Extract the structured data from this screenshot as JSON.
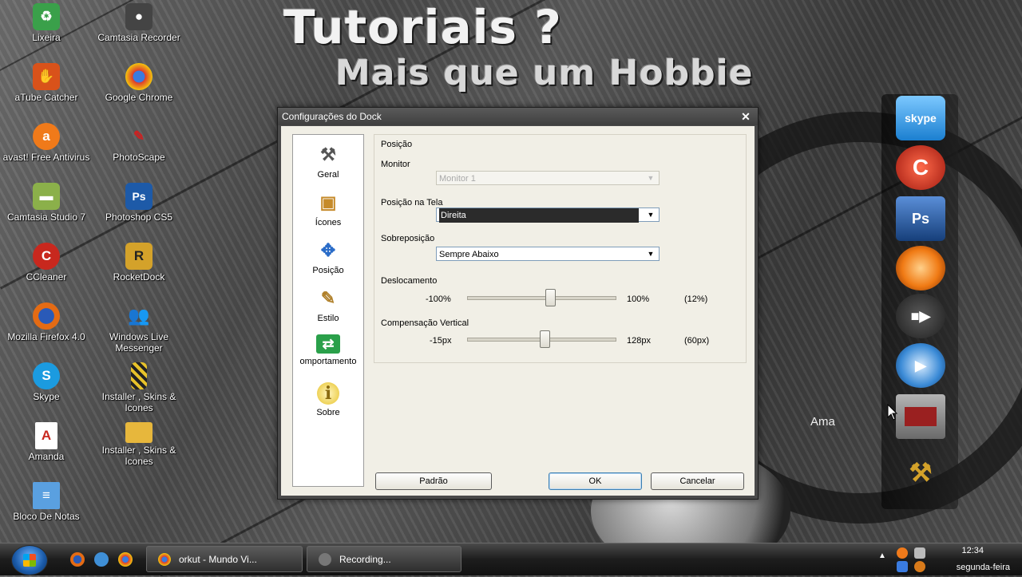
{
  "desktop": {
    "banner_line1": "Tutoriais ?",
    "banner_line2": "Mais que um Hobbie",
    "background_text": "Ama",
    "icons": [
      {
        "label": "Lixeira",
        "icon": "recycle-bin-icon",
        "color": "#3aa04a"
      },
      {
        "label": "Camtasia Recorder",
        "icon": "camtasia-recorder-icon",
        "color": "#444444"
      },
      {
        "label": "aTube Catcher",
        "icon": "atube-catcher-icon",
        "color": "#d9521a"
      },
      {
        "label": "Google Chrome",
        "icon": "chrome-icon",
        "color": "#dd3a2e"
      },
      {
        "label": "avast! Free Antivirus",
        "icon": "avast-icon",
        "color": "#f07a1a"
      },
      {
        "label": "PhotoScape",
        "icon": "photoscape-icon",
        "color": "#cc2222"
      },
      {
        "label": "Camtasia Studio 7",
        "icon": "camtasia-studio-icon",
        "color": "#8bb04a"
      },
      {
        "label": "Photoshop CS5",
        "icon": "photoshop-icon",
        "color": "#1d5aa8"
      },
      {
        "label": "CCleaner",
        "icon": "ccleaner-icon",
        "color": "#c8281e"
      },
      {
        "label": "RocketDock",
        "icon": "rocketdock-icon",
        "color": "#d4a22a"
      },
      {
        "label": "Mozilla Firefox 4.0",
        "icon": "firefox-icon",
        "color": "#e46b14"
      },
      {
        "label": "Windows Live Messenger",
        "icon": "messenger-icon",
        "color": "#3f8fd6"
      },
      {
        "label": "Skype",
        "icon": "skype-icon",
        "color": "#1b9be0"
      },
      {
        "label": "Installer , Skins & Icones",
        "icon": "installer-icon",
        "color": "#2a2a2a"
      },
      {
        "label": "Amanda",
        "icon": "document-icon",
        "color": "#ffffff"
      },
      {
        "label": "Installer , Skins & Icones",
        "icon": "folder-icon",
        "color": "#e7b73c"
      },
      {
        "label": "Bloco De Notas",
        "icon": "notepad-icon",
        "color": "#5aa0e0"
      }
    ]
  },
  "dock": {
    "items": [
      {
        "icon": "skype-dock-icon",
        "text": "skype",
        "color": "#2a9be0"
      },
      {
        "icon": "ccleaner-dock-icon",
        "text": "C",
        "color": "#c8281e"
      },
      {
        "icon": "photoshop-dock-icon",
        "text": "Ps",
        "color": "#1d5aa8"
      },
      {
        "icon": "media-player-dock-icon",
        "text": "",
        "color": "#f07a14"
      },
      {
        "icon": "camera-dock-icon",
        "text": "",
        "color": "#3a3a3a"
      },
      {
        "icon": "play-dock-icon",
        "text": "",
        "color": "#3a8ad6"
      },
      {
        "icon": "recycle-bin-dock-icon",
        "text": "",
        "color": "#9a2020"
      },
      {
        "icon": "settings-tools-dock-icon",
        "text": "",
        "color": "#d4a22a"
      }
    ]
  },
  "dialog": {
    "title": "Configurações do Dock",
    "sidebar": [
      {
        "label": "Geral",
        "icon": "tools-icon",
        "glyph": "⚒",
        "color": "#555555"
      },
      {
        "label": "Ícones",
        "icon": "icons-box-icon",
        "glyph": "▣",
        "color": "#c58a2a"
      },
      {
        "label": "Posição",
        "icon": "position-arrows-icon",
        "glyph": "✥",
        "color": "#2a6cc8"
      },
      {
        "label": "Estilo",
        "icon": "brush-icon",
        "glyph": "✎",
        "color": "#b0802a"
      },
      {
        "label": "omportamento",
        "icon": "behavior-arrows-icon",
        "glyph": "⇄",
        "color": "#2aa04a"
      },
      {
        "label": "Sobre",
        "icon": "info-icon",
        "glyph": "i",
        "color": "#c8a21a"
      }
    ],
    "section_title": "Posição",
    "monitor_label": "Monitor",
    "monitor_value": "Monitor 1",
    "screen_position_label": "Posição na Tela",
    "screen_position_value": "Direita",
    "overlap_label": "Sobreposição",
    "overlap_value": "Sempre Abaixo",
    "offset": {
      "label": "Deslocamento",
      "min_label": "-100%",
      "max_label": "100%",
      "current_label": "(12%)",
      "min": -100,
      "max": 100,
      "value": 12
    },
    "vertical": {
      "label": "Compensação Vertical",
      "min_label": "-15px",
      "max_label": "128px",
      "current_label": "(60px)",
      "min": -15,
      "max": 128,
      "value": 60
    },
    "buttons": {
      "default": "Padrão",
      "ok": "OK",
      "cancel": "Cancelar"
    }
  },
  "taskbar": {
    "tasks": [
      {
        "label": "orkut - Mundo Vi...",
        "icon": "chrome-task-icon",
        "color": "#dd3a2e"
      },
      {
        "label": "Recording...",
        "icon": "recording-task-icon",
        "color": "#777777"
      }
    ],
    "time": "12:34",
    "day": "segunda-feira"
  }
}
